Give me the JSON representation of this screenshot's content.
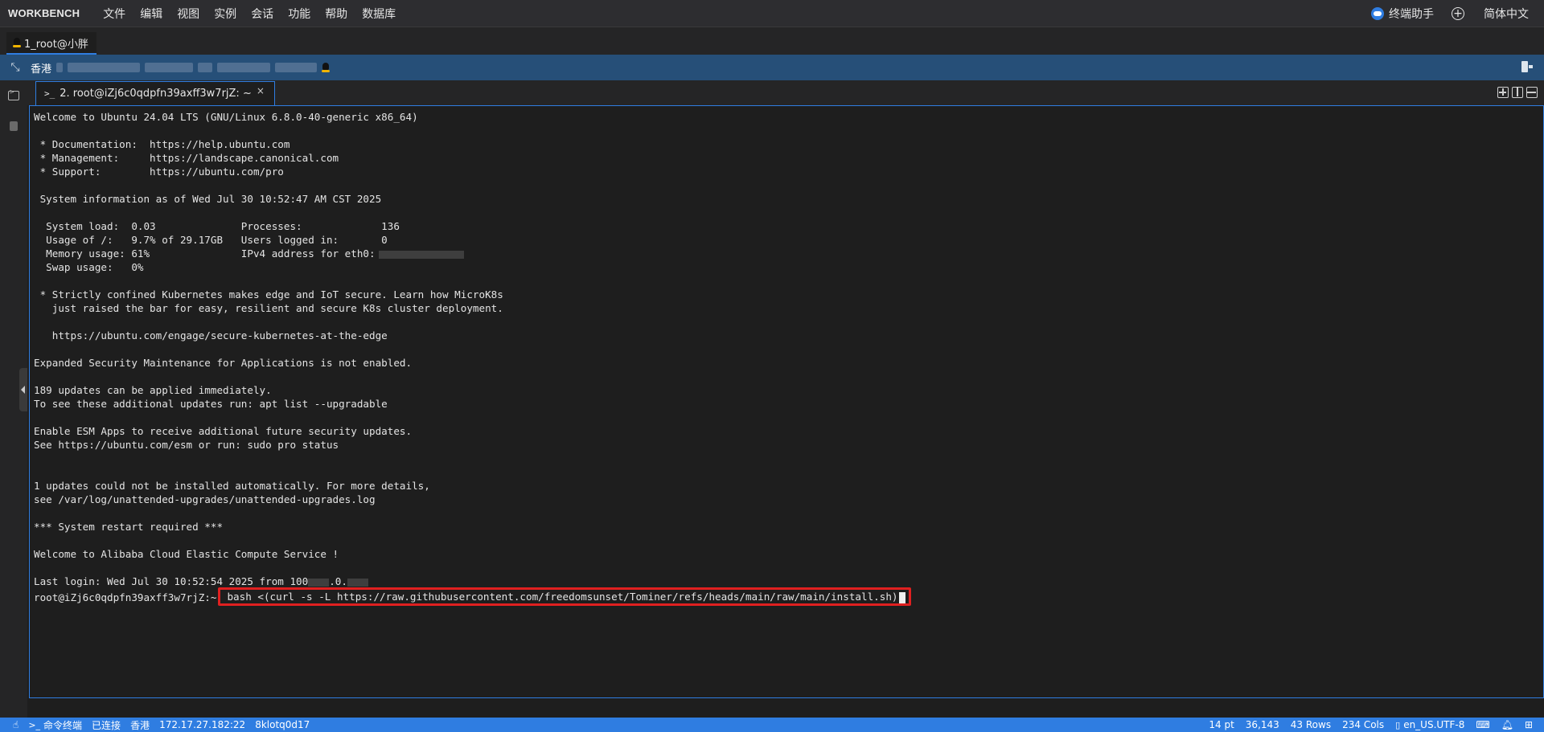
{
  "app": {
    "brand": "WORKBENCH"
  },
  "menu": {
    "items": [
      "文件",
      "编辑",
      "视图",
      "实例",
      "会话",
      "功能",
      "帮助",
      "数据库"
    ]
  },
  "menubar_right": {
    "assistant": "终端助手",
    "language": "简体中文"
  },
  "session_tab": {
    "label": "1_root@小胖"
  },
  "host": {
    "region": "香港"
  },
  "terminal_tab": {
    "label": "2. root@iZj6c0qdpfn39axff3w7rjZ: ~",
    "close": "×"
  },
  "terminal": {
    "lines": [
      "Welcome to Ubuntu 24.04 LTS (GNU/Linux 6.8.0-40-generic x86_64)",
      "",
      " * Documentation:  https://help.ubuntu.com",
      " * Management:     https://landscape.canonical.com",
      " * Support:        https://ubuntu.com/pro",
      "",
      " System information as of Wed Jul 30 10:52:47 AM CST 2025",
      "",
      "  System load:  0.03              Processes:             136",
      "  Usage of /:   9.7% of 29.17GB   Users logged in:       0",
      "  Memory usage: 61%               IPv4 address for eth0:",
      "  Swap usage:   0%",
      "",
      " * Strictly confined Kubernetes makes edge and IoT secure. Learn how MicroK8s",
      "   just raised the bar for easy, resilient and secure K8s cluster deployment.",
      "",
      "   https://ubuntu.com/engage/secure-kubernetes-at-the-edge",
      "",
      "Expanded Security Maintenance for Applications is not enabled.",
      "",
      "189 updates can be applied immediately.",
      "To see these additional updates run: apt list --upgradable",
      "",
      "Enable ESM Apps to receive additional future security updates.",
      "See https://ubuntu.com/esm or run: sudo pro status",
      "",
      "",
      "1 updates could not be installed automatically. For more details,",
      "see /var/log/unattended-upgrades/unattended-upgrades.log",
      "",
      "*** System restart required ***",
      "",
      "Welcome to Alibaba Cloud Elastic Compute Service !",
      ""
    ],
    "last_login_prefix": "Last login: Wed Jul 30 10:52:54 2025 from 100",
    "last_login_mid": ".0.",
    "prompt": "root@iZj6c0qdpfn39axff3w7rjZ:~",
    "command": "bash <(curl -s -L https://raw.githubusercontent.com/freedomsunset/Tominer/refs/heads/main/raw/main/install.sh)",
    "highlight_color": "#e02020"
  },
  "statusbar": {
    "left": [
      "命令终端",
      "已连接",
      "香港",
      "172.17.27.182:22",
      "8klotq0d17"
    ],
    "right": [
      "14 pt",
      "36,143",
      "43 Rows",
      "234 Cols",
      "en_US.UTF-8"
    ]
  },
  "colors": {
    "accent": "#2f7de1",
    "host_bar": "#264f78",
    "background": "#1e1e1e"
  }
}
